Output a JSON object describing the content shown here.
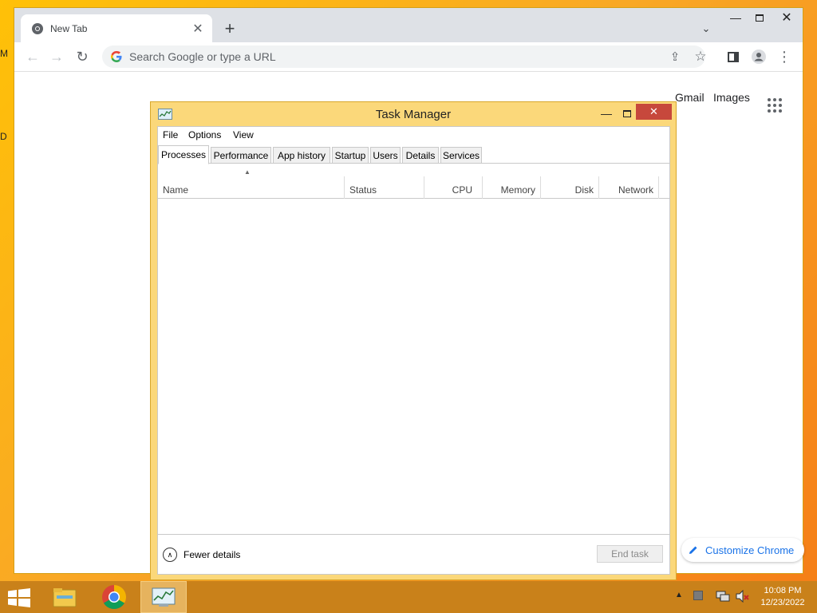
{
  "desktop": {
    "left_fragments": [
      "M",
      "D"
    ]
  },
  "browser": {
    "tab": {
      "title": "New Tab"
    },
    "omnibox": {
      "placeholder": "Search Google or type a URL"
    },
    "ntp": {
      "gmail": "Gmail",
      "images": "Images",
      "customize": "Customize Chrome"
    }
  },
  "task_manager": {
    "title": "Task Manager",
    "menu": [
      "File",
      "Options",
      "View"
    ],
    "tabs": [
      "Processes",
      "Performance",
      "App history",
      "Startup",
      "Users",
      "Details",
      "Services"
    ],
    "active_tab": "Processes",
    "columns": [
      "Name",
      "Status",
      "CPU",
      "Memory",
      "Disk",
      "Network"
    ],
    "footer": {
      "fewer_details": "Fewer details",
      "end_task": "End task"
    }
  },
  "taskbar": {
    "items": [
      "file-explorer-icon",
      "chrome-icon",
      "task-manager-icon"
    ],
    "clock": {
      "time": "10:08 PM",
      "date": "12/23/2022"
    }
  },
  "colors": {
    "desktop": "#f9a825",
    "taskbar": "#c9811a",
    "tm_frame": "#fbd87a",
    "close_red": "#c7483c",
    "link_blue": "#1a73e8"
  }
}
